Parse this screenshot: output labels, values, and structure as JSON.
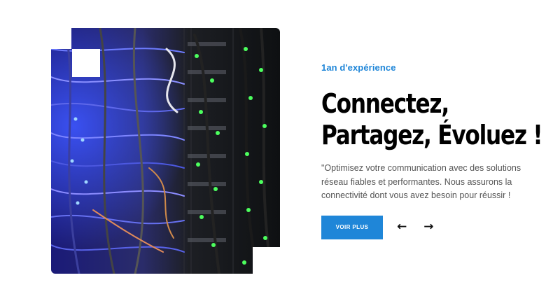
{
  "hero": {
    "image_label": "server rack with network cables",
    "eyebrow": "1an d'expérience",
    "headline_line1": "Connectez,",
    "headline_line2": "Partagez, Évoluez !",
    "description": "\"Optimisez votre communication avec des solutions réseau fiables et performantes. Nous assurons la connectivité dont vous avez besoin pour réussir !",
    "cta_label": "VOIR PLUS",
    "prev_arrow": "←",
    "next_arrow": "→"
  },
  "colors": {
    "accent": "#1f86d8",
    "headline": "#000000",
    "body_text": "#555555"
  }
}
